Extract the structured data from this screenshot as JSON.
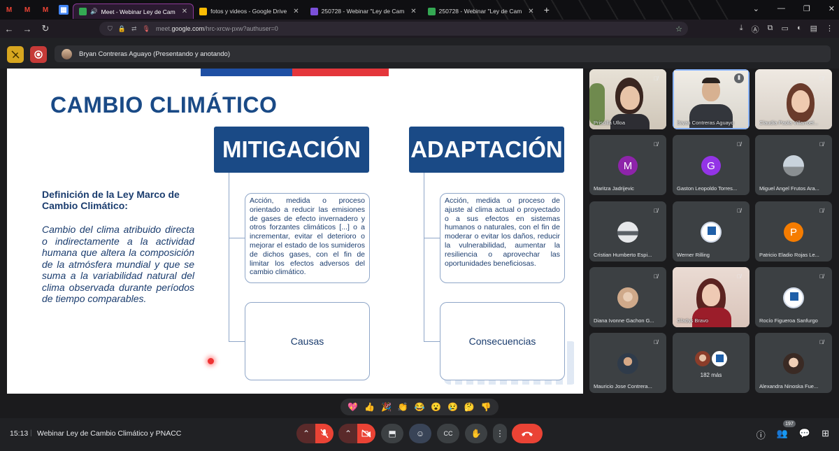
{
  "browser": {
    "tabs": [
      {
        "label": "Meet - Webinar Ley de Cam",
        "active": true,
        "favicon_color": "#34a853"
      },
      {
        "label": "fotos y videos - Google Drive",
        "active": false,
        "favicon_color": "#fbbc04"
      },
      {
        "label": "250728 - Webinar \"Ley de Cam",
        "active": false,
        "favicon_color": "#7b50d9"
      },
      {
        "label": "250728 - Webinar \"Ley de Cam",
        "active": false,
        "favicon_color": "#34a853"
      }
    ],
    "pinned": [
      "M",
      "M",
      "M"
    ],
    "url_prefix": "meet.",
    "url_domain": "google.com",
    "url_path": "/hrc-xrcw-pxw?authuser=0"
  },
  "meet": {
    "presenter": "Bryan Contreras Aguayo (Presentando y anotando)"
  },
  "slide": {
    "title": "CAMBIO CLIMÁTICO",
    "mitigation_header": "MITIGACIÓN",
    "adaptation_header": "ADAPTACIÓN",
    "definition_title": "Definición de la Ley Marco de Cambio Climático:",
    "definition_body": "Cambio del clima atribuido directa o indirectamente a la actividad humana que altera la composición de la atmósfera mundial y que se suma a la variabilidad natural del clima observada durante períodos de tiempo comparables.",
    "mitigation_text": "Acción, medida o proceso orientado a reducir las emisiones de gases de efecto invernadero y otros forzantes climáticos [...] o a incrementar, evitar el deterioro o mejorar el estado de los sumideros de dichos gases, con el fin de limitar los efectos adversos del cambio climático.",
    "adaptation_text": "Acción, medida o proceso de ajuste al clima actual o proyectado o a sus efectos en sistemas humanos o naturales, con el fin de moderar o evitar los daños, reducir la vulnerabilidad, aumentar la resiliencia o aprovechar las oportunidades beneficiosas.",
    "causes_label": "Causas",
    "consequences_label": "Consecuencias"
  },
  "participants": [
    {
      "name": "Priscilla Ulloa",
      "kind": "video"
    },
    {
      "name": "Bryan Contreras Aguayo",
      "kind": "video"
    },
    {
      "name": "Claudia Paola Villarroel...",
      "kind": "video"
    },
    {
      "name": "Maritza Jadrijevic",
      "kind": "letter",
      "letter": "M",
      "color": "#8e24aa"
    },
    {
      "name": "Gaston Leopoldo Torres...",
      "kind": "letter",
      "letter": "G",
      "color": "#9334e6"
    },
    {
      "name": "Miguel Angel Frutos Ara...",
      "kind": "photo"
    },
    {
      "name": "Cristian Humberto Espi...",
      "kind": "photo"
    },
    {
      "name": "Werner Rilling",
      "kind": "photo"
    },
    {
      "name": "Patricio Eladio Rojas Le...",
      "kind": "letter",
      "letter": "P",
      "color": "#f57c00"
    },
    {
      "name": "Diana Ivonne Gachon G...",
      "kind": "photo"
    },
    {
      "name": "Gladys Bravo",
      "kind": "video"
    },
    {
      "name": "Rocío Figueroa Sanfurgo",
      "kind": "photo"
    },
    {
      "name": "Mauricio Jose Contrera...",
      "kind": "photo"
    },
    {
      "name": "182 más",
      "kind": "more"
    },
    {
      "name": "Alexandra Ninoska Fue...",
      "kind": "photo"
    }
  ],
  "reactions": [
    "💖",
    "👍",
    "🎉",
    "👏",
    "😂",
    "😮",
    "😢",
    "🤔",
    "👎"
  ],
  "bottom": {
    "time": "15:13",
    "separator": "|",
    "meeting_title": "Webinar Ley de Cambio Climático y PNACC",
    "people_count": "197"
  }
}
